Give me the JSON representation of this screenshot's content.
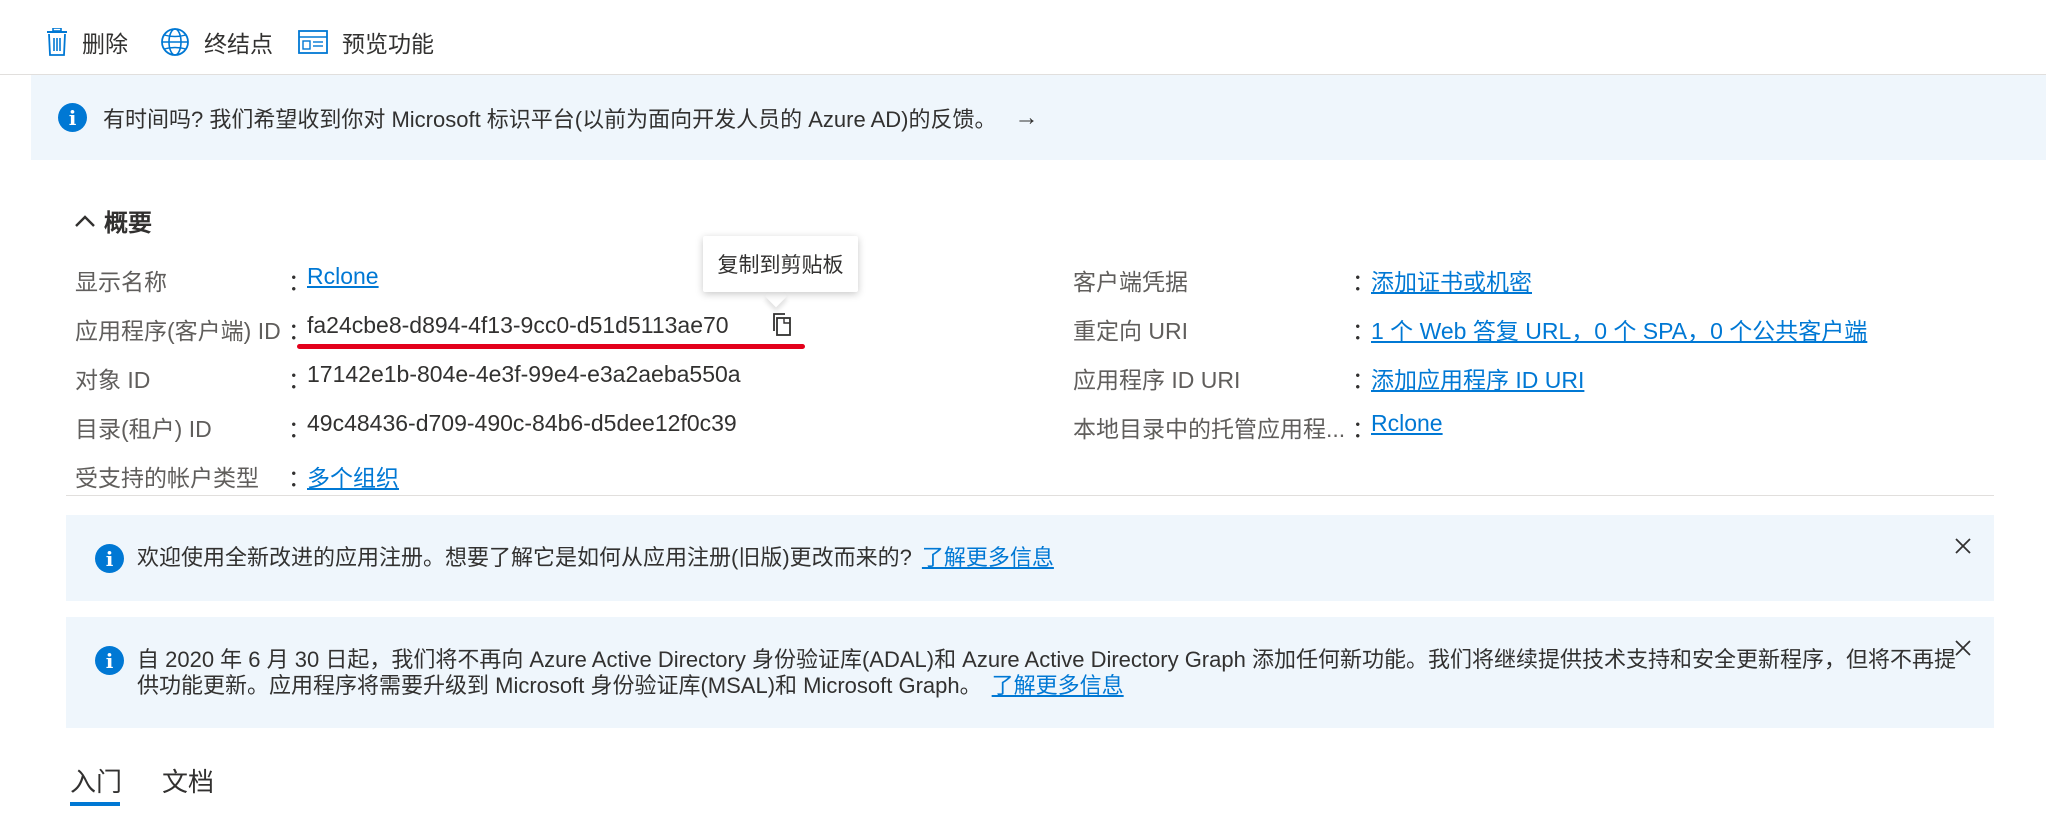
{
  "toolbar": {
    "delete_label": "删除",
    "endpoints_label": "终结点",
    "preview_label": "预览功能"
  },
  "feedback": {
    "text": "有时间吗? 我们希望收到你对 Microsoft 标识平台(以前为面向开发人员的 Azure AD)的反馈。",
    "arrow": "→"
  },
  "overview": {
    "title": "概要",
    "left": [
      {
        "label": "显示名称",
        "value": "Rclone",
        "link": true
      },
      {
        "label": "应用程序(客户端) ID",
        "value": "fa24cbe8-d894-4f13-9cc0-d51d5113ae70",
        "link": false
      },
      {
        "label": "对象 ID",
        "value": "17142e1b-804e-4e3f-99e4-e3a2aeba550a",
        "link": false
      },
      {
        "label": "目录(租户) ID",
        "value": "49c48436-d709-490c-84b6-d5dee12f0c39",
        "link": false
      },
      {
        "label": "受支持的帐户类型",
        "value": "多个组织",
        "link": true
      }
    ],
    "right": [
      {
        "label": "客户端凭据",
        "value": "添加证书或机密",
        "link": true
      },
      {
        "label": "重定向 URI",
        "value": "1 个 Web 答复 URL，0 个 SPA，0 个公共客户端",
        "link": true
      },
      {
        "label": "应用程序 ID URI",
        "value": "添加应用程序 ID URI",
        "link": true
      },
      {
        "label": "本地目录中的托管应用程...",
        "value": "Rclone",
        "link": true
      }
    ],
    "colon": "："
  },
  "tooltip": {
    "text": "复制到剪贴板"
  },
  "banner1": {
    "text": "欢迎使用全新改进的应用注册。想要了解它是如何从应用注册(旧版)更改而来的?",
    "link": "了解更多信息"
  },
  "banner2": {
    "text": "自 2020 年 6 月 30 日起，我们将不再向 Azure Active Directory 身份验证库(ADAL)和 Azure Active Directory Graph 添加任何新功能。我们将继续提供技术支持和安全更新程序，但将不再提供功能更新。应用程序将需要升级到 Microsoft 身份验证库(MSAL)和 Microsoft Graph。",
    "link": "了解更多信息"
  },
  "tabs": [
    {
      "label": "入门",
      "active": true
    },
    {
      "label": "文档",
      "active": false
    }
  ],
  "colors": {
    "accent": "#0078d4",
    "highlight": "#e3001b",
    "banner_bg": "#eff6fc"
  }
}
